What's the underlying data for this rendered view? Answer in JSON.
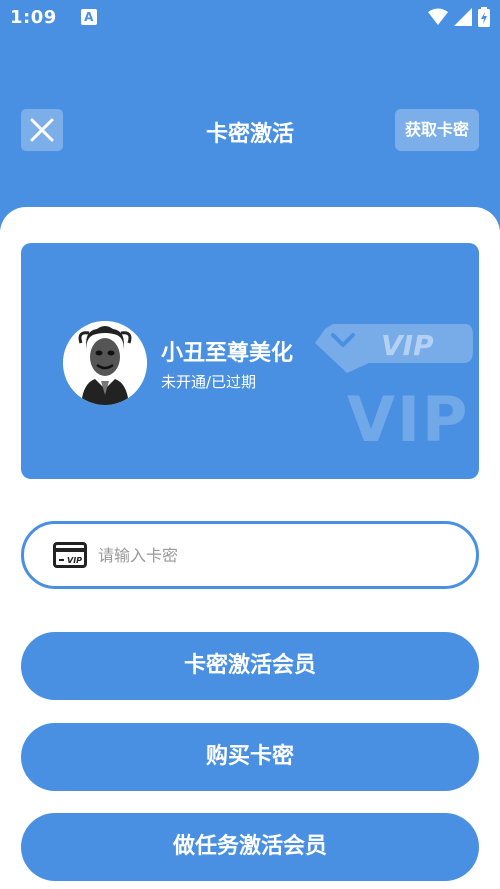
{
  "status_bar": {
    "time": "1:09",
    "app_icon_letter": "A",
    "icons": [
      "wifi-icon",
      "signal-icon",
      "battery-icon"
    ]
  },
  "toolbar": {
    "title": "卡密激活",
    "right_button_label": "获取卡密",
    "left_icon": "close-icon"
  },
  "vip_card": {
    "user_name": "小丑至尊美化",
    "status": "未开通/已过期",
    "badge_text": "VIP",
    "watermark_text": "VIP"
  },
  "card_input": {
    "placeholder": "请输入卡密",
    "value": "",
    "icon": "vip-card-icon"
  },
  "buttons": {
    "activate": "卡密激活会员",
    "buy": "购买卡密",
    "task_activate": "做任务激活会员"
  },
  "colors": {
    "primary": "#4A90E2",
    "background": "#FFFFFF"
  }
}
